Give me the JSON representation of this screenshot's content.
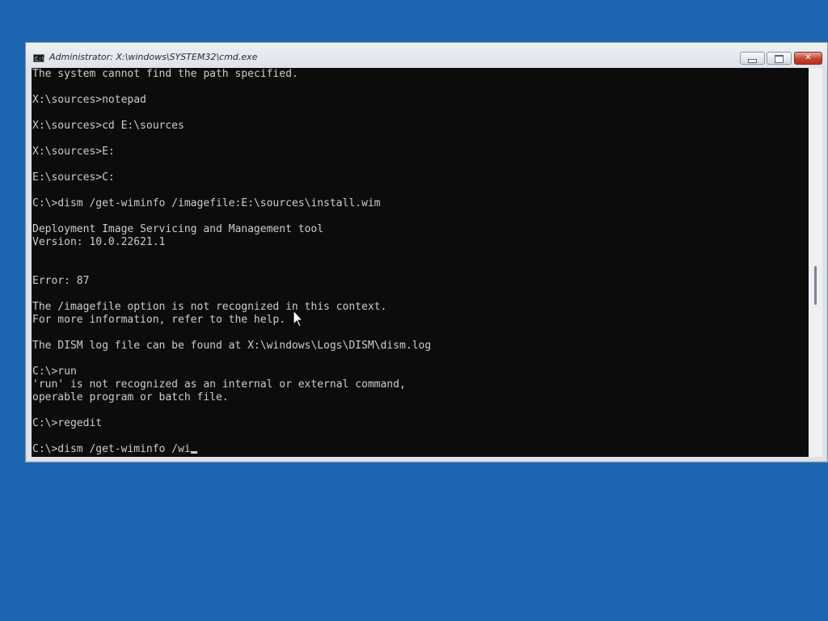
{
  "window": {
    "title": "Administrator: X:\\windows\\SYSTEM32\\cmd.exe",
    "icon_text": "C:\\",
    "controls": {
      "minimize": "minimize",
      "maximize": "restore",
      "close": "✕"
    }
  },
  "console": {
    "lines": [
      "The system cannot find the path specified.",
      "",
      "X:\\sources>notepad",
      "",
      "X:\\sources>cd E:\\sources",
      "",
      "X:\\sources>E:",
      "",
      "E:\\sources>C:",
      "",
      "C:\\>dism /get-wiminfo /imagefile:E:\\sources\\install.wim",
      "",
      "Deployment Image Servicing and Management tool",
      "Version: 10.0.22621.1",
      "",
      "",
      "Error: 87",
      "",
      "The /imagefile option is not recognized in this context.",
      "For more information, refer to the help.",
      "",
      "The DISM log file can be found at X:\\windows\\Logs\\DISM\\dism.log",
      "",
      "C:\\>run",
      "'run' is not recognized as an internal or external command,",
      "operable program or batch file.",
      "",
      "C:\\>regedit",
      "",
      "C:\\>dism /get-wiminfo /wi"
    ]
  },
  "colors": {
    "desktop": "#1e65b2",
    "console_bg": "#0c0c0c",
    "console_text": "#cccccc",
    "close_button": "#c5422e"
  },
  "icons": {
    "app": "cmd-icon",
    "pointer": "mouse-pointer-icon"
  }
}
